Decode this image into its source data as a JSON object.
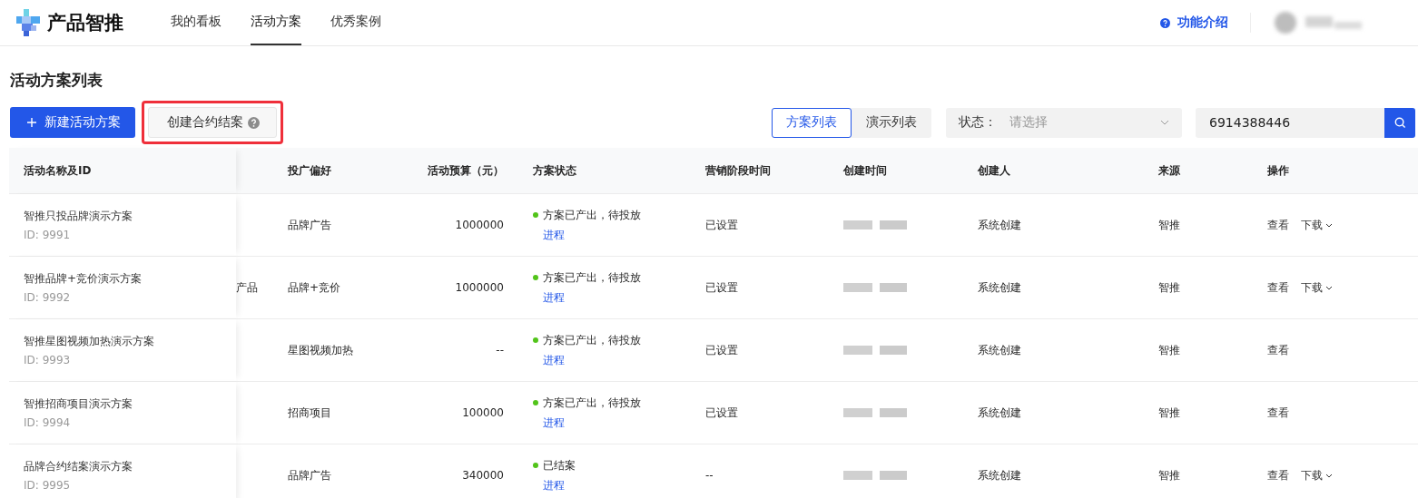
{
  "header": {
    "brand": "产品智推",
    "nav": [
      {
        "label": "我的看板",
        "selected": false
      },
      {
        "label": "活动方案",
        "selected": true
      },
      {
        "label": "优秀案例",
        "selected": false
      }
    ],
    "help_link": "功能介绍"
  },
  "page_title": "活动方案列表",
  "toolbar": {
    "buttons": [
      {
        "label": "新建活动方案",
        "kind": "primary",
        "highlighted": false
      },
      {
        "label": "创建合约结案",
        "kind": "help",
        "highlighted": true
      }
    ],
    "view_toggle": [
      {
        "label": "方案列表",
        "selected": true
      },
      {
        "label": "演示列表",
        "selected": false
      }
    ],
    "status_filter": {
      "label": "状态：",
      "placeholder": "请选择"
    },
    "search": {
      "value": "6914388446"
    }
  },
  "table": {
    "columns": [
      "活动名称及ID",
      "",
      "投广偏好",
      "活动预算（元）",
      "方案状态",
      "营销阶段时间",
      "创建时间",
      "创建人",
      "来源",
      "操作"
    ],
    "rows": [
      {
        "name": "智推只投品牌演示方案",
        "id": "ID: 9991",
        "column_2": "",
        "preference": "品牌广告",
        "budget": "1000000",
        "status": "方案已产出，待投放",
        "progress_link": "进程",
        "marketing": "已设置",
        "creator": "系统创建",
        "source": "智推",
        "actions": [
          {
            "label": "查看",
            "kind": "link"
          },
          {
            "label": "下载",
            "kind": "dropdown"
          }
        ]
      },
      {
        "name": "智推品牌+竞价演示方案",
        "id": "ID: 9992",
        "column_2": "产品",
        "preference": "品牌+竞价",
        "budget": "1000000",
        "status": "方案已产出，待投放",
        "progress_link": "进程",
        "marketing": "已设置",
        "creator": "系统创建",
        "source": "智推",
        "actions": [
          {
            "label": "查看",
            "kind": "link"
          },
          {
            "label": "下载",
            "kind": "dropdown"
          }
        ]
      },
      {
        "name": "智推星图视频加热演示方案",
        "id": "ID: 9993",
        "column_2": "",
        "preference": "星图视频加热",
        "budget": "--",
        "status": "方案已产出，待投放",
        "progress_link": "进程",
        "marketing": "已设置",
        "creator": "系统创建",
        "source": "智推",
        "actions": [
          {
            "label": "查看",
            "kind": "link"
          }
        ]
      },
      {
        "name": "智推招商项目演示方案",
        "id": "ID: 9994",
        "column_2": "",
        "preference": "招商项目",
        "budget": "100000",
        "status": "方案已产出，待投放",
        "progress_link": "进程",
        "marketing": "已设置",
        "creator": "系统创建",
        "source": "智推",
        "actions": [
          {
            "label": "查看",
            "kind": "link"
          }
        ]
      },
      {
        "name": "品牌合约结案演示方案",
        "id": "ID: 9995",
        "column_2": "",
        "preference": "品牌广告",
        "budget": "340000",
        "status": "已结案",
        "progress_link": "进程",
        "marketing": "--",
        "creator": "系统创建",
        "source": "智推",
        "actions": [
          {
            "label": "查看",
            "kind": "link"
          },
          {
            "label": "下载",
            "kind": "dropdown"
          }
        ]
      }
    ]
  }
}
